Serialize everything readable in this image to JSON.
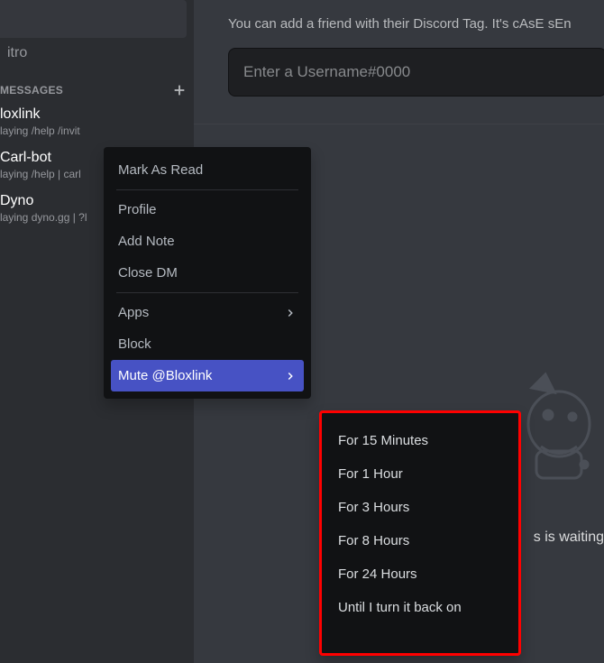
{
  "sidebar": {
    "nitro": "itro",
    "dm_header": "MESSAGES",
    "dms": [
      {
        "name": "loxlink",
        "status": "laying /help /invit"
      },
      {
        "name": "Carl-bot",
        "status": "laying /help | carl"
      },
      {
        "name": "Dyno",
        "status": "laying dyno.gg | ?l"
      }
    ]
  },
  "main": {
    "help_text": "You can add a friend with their Discord Tag. It's cAsE sEn",
    "input_placeholder": "Enter a Username#0000",
    "waiting_text": "s is waiting"
  },
  "context_menu": {
    "mark_read": "Mark As Read",
    "profile": "Profile",
    "add_note": "Add Note",
    "close_dm": "Close DM",
    "apps": "Apps",
    "block": "Block",
    "mute": "Mute @Bloxlink"
  },
  "submenu": {
    "m15": "For 15 Minutes",
    "h1": "For 1 Hour",
    "h3": "For 3 Hours",
    "h8": "For 8 Hours",
    "h24": "For 24 Hours",
    "until": "Until I turn it back on"
  }
}
